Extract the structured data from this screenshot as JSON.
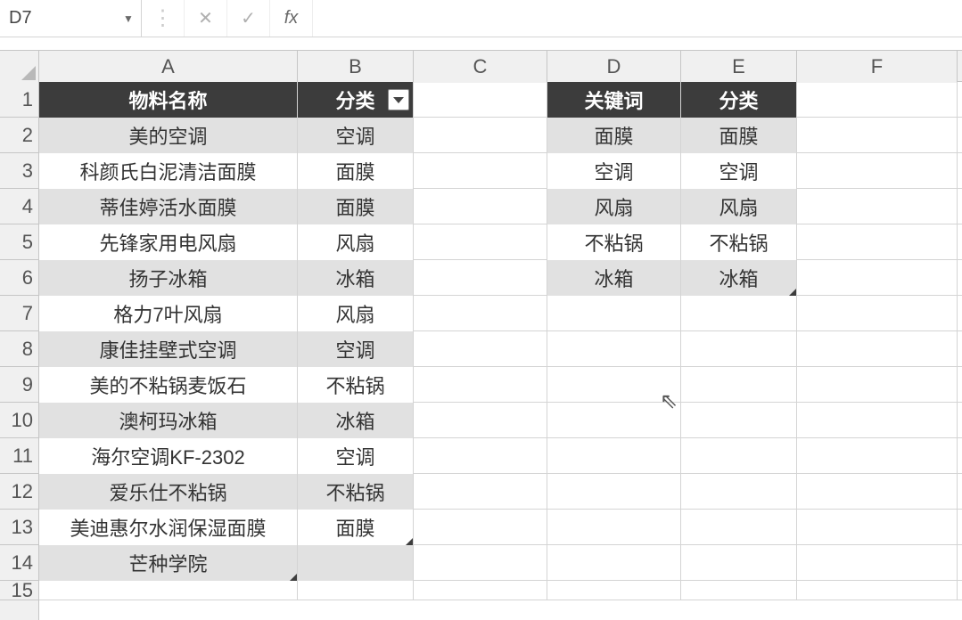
{
  "formula_bar": {
    "name_box": "D7",
    "fx_label": "fx",
    "formula_value": ""
  },
  "columns": [
    "A",
    "B",
    "C",
    "D",
    "E",
    "F"
  ],
  "row_numbers": [
    "1",
    "2",
    "3",
    "4",
    "5",
    "6",
    "7",
    "8",
    "9",
    "10",
    "11",
    "12",
    "13",
    "14",
    "15"
  ],
  "row_heights": {
    "default": 40,
    "last": 22
  },
  "active_cell": {
    "col": "D",
    "row": 7
  },
  "table1": {
    "headers": {
      "A": "物料名称",
      "B": "分类"
    },
    "rows": [
      {
        "A": "美的空调",
        "B": "空调"
      },
      {
        "A": "科颜氏白泥清洁面膜",
        "B": "面膜"
      },
      {
        "A": "蒂佳婷活水面膜",
        "B": "面膜"
      },
      {
        "A": "先锋家用电风扇",
        "B": "风扇"
      },
      {
        "A": "扬子冰箱",
        "B": "冰箱"
      },
      {
        "A": "格力7叶风扇",
        "B": "风扇"
      },
      {
        "A": "康佳挂壁式空调",
        "B": "空调"
      },
      {
        "A": "美的不粘锅麦饭石",
        "B": "不粘锅"
      },
      {
        "A": "澳柯玛冰箱",
        "B": "冰箱"
      },
      {
        "A": "海尔空调KF-2302",
        "B": "空调"
      },
      {
        "A": "爱乐仕不粘锅",
        "B": "不粘锅"
      },
      {
        "A": "美迪惠尔水润保湿面膜",
        "B": "面膜"
      },
      {
        "A": "芒种学院",
        "B": ""
      }
    ]
  },
  "table2": {
    "headers": {
      "D": "关键词",
      "E": "分类"
    },
    "rows": [
      {
        "D": "面膜",
        "E": "面膜"
      },
      {
        "D": "空调",
        "E": "空调"
      },
      {
        "D": "风扇",
        "E": "风扇"
      },
      {
        "D": "不粘锅",
        "E": "不粘锅"
      },
      {
        "D": "冰箱",
        "E": "冰箱"
      }
    ]
  }
}
